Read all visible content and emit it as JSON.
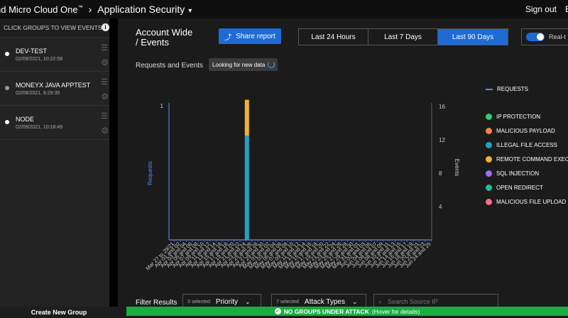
{
  "topbar": {
    "brand": "nd Micro Cloud One",
    "trademark": "™",
    "app_name": "Application Security",
    "signout": "Sign out",
    "extra": "E"
  },
  "sidebar": {
    "header": "CLICK GROUPS TO VIEW EVENTS",
    "groups": [
      {
        "name": "DEV-TEST",
        "time": "02/09/2021, 10:22:58",
        "status_color": "#ffffff"
      },
      {
        "name": "MONEYX JAVA APPTEST",
        "time": "02/09/2021, 8:29:35",
        "status_color": "#9a9a9a"
      },
      {
        "name": "NODE",
        "time": "02/09/2021, 10:18:49",
        "status_color": "#ffffff"
      }
    ],
    "create_label": "Create New Group"
  },
  "main": {
    "title_line1": "Account Wide",
    "title_line2": "/ Events",
    "share_label": "Share report",
    "ranges": [
      "Last 24 Hours",
      "Last 7 Days",
      "Last 90 Days"
    ],
    "active_range": "Last 90 Days",
    "realtime_label": "Real-t",
    "subtitle": "Requests and Events",
    "looking_label": "Looking for new data"
  },
  "chart_data": {
    "type": "bar",
    "ylabel_left": "Requests",
    "ylabel_right": "Events",
    "left_ticks": [
      "1"
    ],
    "right_ticks": [
      "16",
      "12",
      "8",
      "4"
    ],
    "right_ylim": [
      0,
      16
    ],
    "categories": [
      "Mar 27 to 29/21",
      "Apr 01 and 02",
      "Apr 03 and 04",
      "Apr 05 and 06",
      "Apr 07 and 08",
      "Apr 09 and 10",
      "Apr 11 and 12",
      "Apr 13 and 14",
      "Apr 15 and 16",
      "Apr 17 and 18",
      "Apr 19 and 20",
      "Apr 21 and 22",
      "Apr 23 and 24",
      "Apr 25 and 26",
      "Apr 27 and 28",
      "Apr 29 and 30",
      "May 01 and 02",
      "May 03 and 04",
      "May 05 and 06",
      "May 07 and 08",
      "May 09 and 10",
      "May 11 and 12",
      "May 13 and 14",
      "May 15 and 16",
      "May 17 and 18",
      "May 19 and 20",
      "May 21 and 22",
      "May 23 and 24",
      "May 25 and 26",
      "May 27 and 28",
      "May 29 and 30",
      "May 31 and 01",
      "Jun 02 and 03",
      "Jun 04 and 05",
      "Jun 06 and 07",
      "Jun 08 and 09",
      "Jun 10 and 11",
      "Jun 12 and 13",
      "Jun 14 and 15",
      "Jun 16 and 17",
      "Jun 18 and 19",
      "Jun 20 and 21",
      "Jun 22 and 23",
      "Jun 24 and 25"
    ],
    "series": [
      {
        "name": "ILLEGAL FILE ACCESS",
        "color": "#1ea3c8",
        "index": 12,
        "value": 12.5
      },
      {
        "name": "REMOTE COMMAND EXECU",
        "color": "#f0b429",
        "index": 12,
        "value": 4.3
      }
    ],
    "legend": [
      {
        "name": "REQUESTS",
        "color": "#5a8cff",
        "kind": "line"
      },
      {
        "name": "IP PROTECTION",
        "color": "#2ecc71",
        "kind": "dot"
      },
      {
        "name": "MALICIOUS PAYLOAD",
        "color": "#ff7f3f",
        "kind": "dot"
      },
      {
        "name": "ILLEGAL FILE ACCESS",
        "color": "#1ea3c8",
        "kind": "dot"
      },
      {
        "name": "REMOTE COMMAND EXECU",
        "color": "#f0b429",
        "kind": "dot"
      },
      {
        "name": "SQL INJECTION",
        "color": "#9b6dff",
        "kind": "dot"
      },
      {
        "name": "OPEN REDIRECT",
        "color": "#1fbf9a",
        "kind": "dot"
      },
      {
        "name": "MALICIOUS FILE UPLOAD",
        "color": "#ff6b8a",
        "kind": "dot"
      }
    ]
  },
  "filters": {
    "label": "Filter Results",
    "priority": {
      "count": "3 selected",
      "label": "Priority"
    },
    "attack_types": {
      "count": "7 selected",
      "label": "Attack Types"
    },
    "search_placeholder": "Search Source IP"
  },
  "status": {
    "text": "NO GROUPS UNDER ATTACK",
    "hint": "(Hover for details)"
  }
}
